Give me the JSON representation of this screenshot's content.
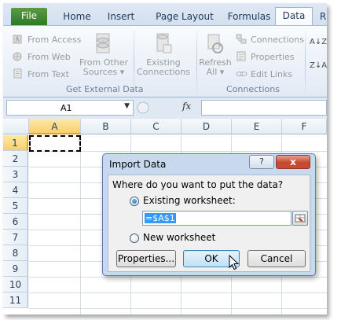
{
  "ribbon": {
    "tabs": [
      {
        "label": "File"
      },
      {
        "label": "Home"
      },
      {
        "label": "Insert"
      },
      {
        "label": "Page Layout"
      },
      {
        "label": "Formulas"
      },
      {
        "label": "Data"
      },
      {
        "label": "R"
      }
    ],
    "active_tab": "Data",
    "get_external": {
      "from_access": "From Access",
      "from_web": "From Web",
      "from_text": "From Text",
      "from_other_line1": "From Other",
      "from_other_line2": "Sources",
      "existing_line1": "Existing",
      "existing_line2": "Connections",
      "group_label": "Get External Data"
    },
    "connections": {
      "refresh_line1": "Refresh",
      "refresh_line2": "All",
      "connections": "Connections",
      "properties": "Properties",
      "edit_links": "Edit Links",
      "group_label": "Connections"
    },
    "sort_az": "A↓Z",
    "sort_za": "Z↓A"
  },
  "formula_bar": {
    "name_box": "A1",
    "fx": "fx",
    "formula": ""
  },
  "grid": {
    "columns": [
      "A",
      "B",
      "C",
      "D",
      "E",
      "F"
    ],
    "rows": [
      "1",
      "2",
      "3",
      "4",
      "5",
      "6",
      "7",
      "8",
      "9",
      "10",
      "11"
    ],
    "selected_cell": "A1"
  },
  "dialog": {
    "title": "Import Data",
    "help": "?",
    "close": "x",
    "question": "Where do you want to put the data?",
    "existing_worksheet": "Existing worksheet:",
    "existing_selected": true,
    "reference": "=$A$1",
    "new_worksheet": "New worksheet",
    "properties_button": "Properties...",
    "ok_button": "OK",
    "cancel_button": "Cancel"
  },
  "colors": {
    "ribbon_tab_bg": "#dfe8f4",
    "file_tab": "#2f7a26",
    "dialog_frame": "#c8d9ee",
    "close_button": "#c6492f",
    "selection_highlight": "#3399ff"
  }
}
